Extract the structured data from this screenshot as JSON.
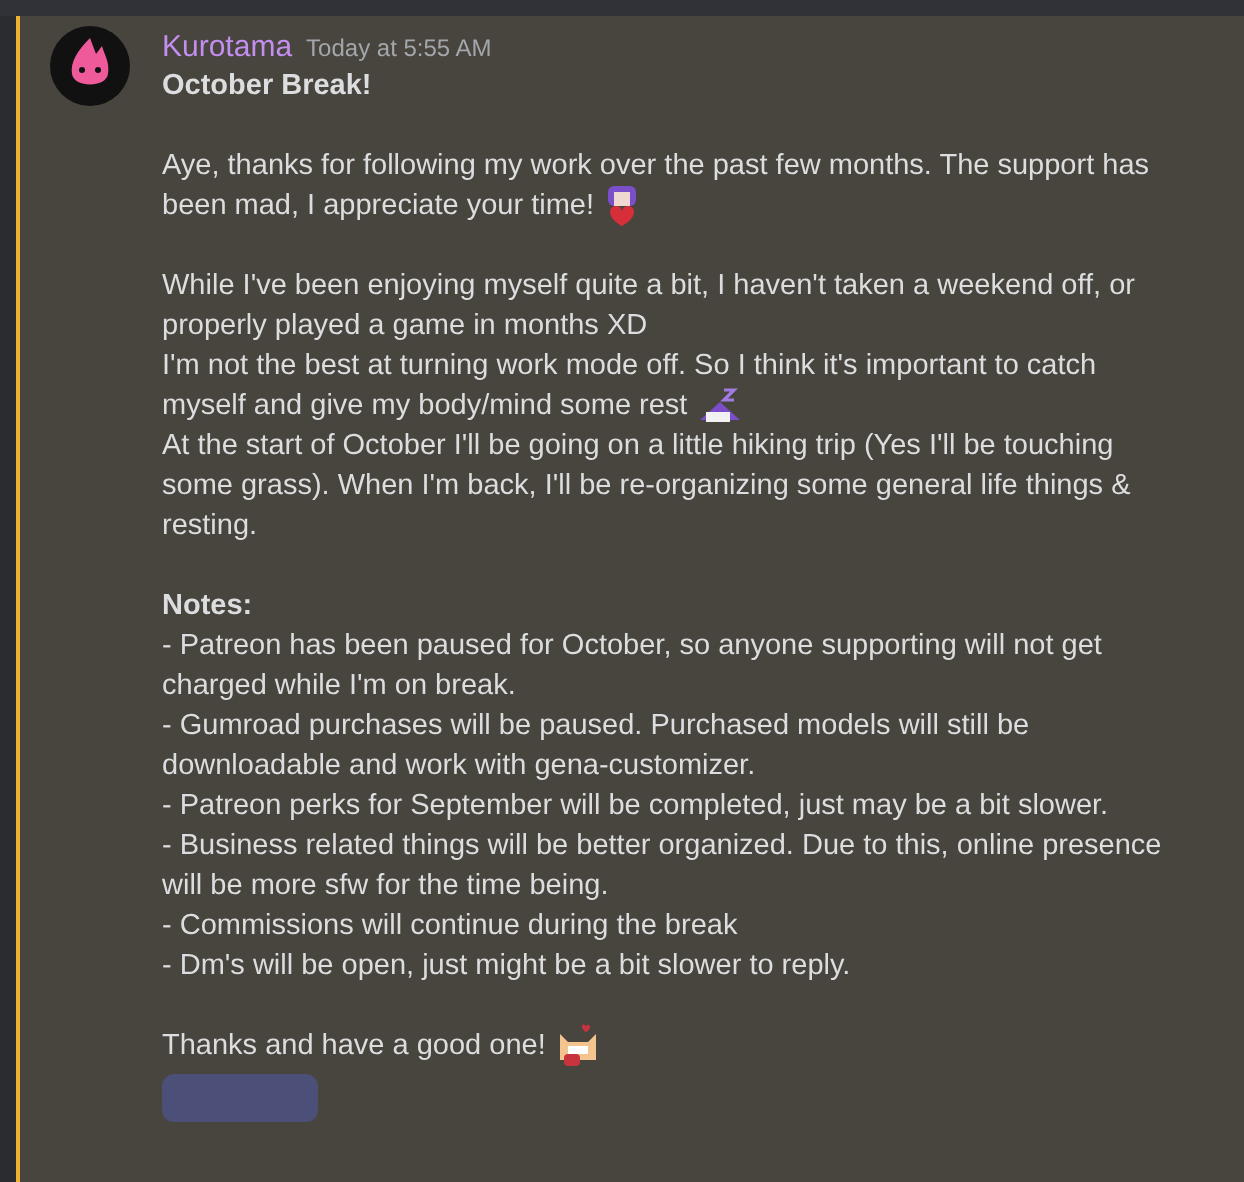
{
  "message": {
    "author": "Kurotama",
    "timestamp": "Today at 5:55 AM",
    "blocks": [
      {
        "kind": "title",
        "lines": [
          "October Break!"
        ]
      },
      {
        "kind": "blank"
      },
      {
        "kind": "text",
        "lines": [
          "Aye, thanks for following my work over the past few months. The support has",
          "been mad, I appreciate your time!"
        ],
        "emoji": {
          "kind": "heart"
        }
      },
      {
        "kind": "blank"
      },
      {
        "kind": "text",
        "lines": [
          "While I've been enjoying myself quite a bit, I haven't taken a weekend off, or",
          "properly played a game in months XD"
        ]
      },
      {
        "kind": "text",
        "lines": [
          "I'm not the best at turning work mode off. So I think it's important to catch",
          "myself and give my body/mind some rest"
        ],
        "emoji": {
          "kind": "sleep"
        }
      },
      {
        "kind": "text",
        "lines": [
          "At the start of October I'll be going on a little hiking trip (Yes I'll be touching",
          "some grass). When I'm back, I'll be re-organizing some general life things &",
          "resting."
        ]
      },
      {
        "kind": "blank"
      },
      {
        "kind": "title",
        "lines": [
          "Notes:"
        ]
      },
      {
        "kind": "text",
        "lines": [
          "- Patreon has been paused for October, so anyone supporting will not get",
          "charged while I'm on break."
        ]
      },
      {
        "kind": "text",
        "lines": [
          "- Gumroad purchases will be paused. Purchased models will still be",
          "downloadable and work with gena-customizer."
        ]
      },
      {
        "kind": "text",
        "lines": [
          "- Patreon perks for September will be completed, just may be a bit slower."
        ]
      },
      {
        "kind": "text",
        "lines": [
          "- Business related things will be better organized. Due to this, online presence",
          "will be more sfw for the time being."
        ]
      },
      {
        "kind": "text",
        "lines": [
          "- Commissions will continue during the break"
        ]
      },
      {
        "kind": "text",
        "lines": [
          "- Dm's will be open, just might be a bit slower to reply."
        ]
      },
      {
        "kind": "blank"
      },
      {
        "kind": "text",
        "lines": [
          "Thanks and have a good one!"
        ],
        "emoji": {
          "kind": "cat"
        }
      }
    ],
    "reaction": true
  }
}
